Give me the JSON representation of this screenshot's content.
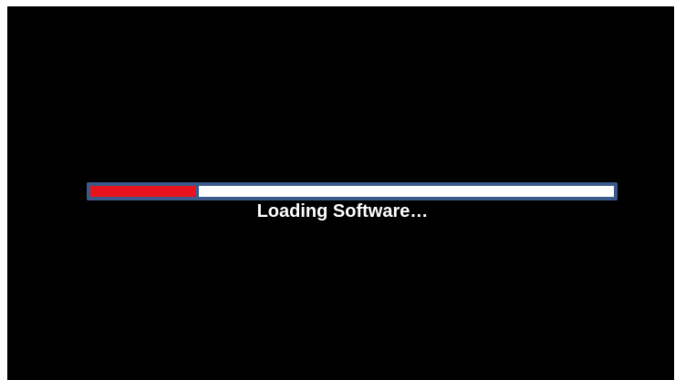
{
  "loading": {
    "message": "Loading Software…",
    "progress": 0.2
  },
  "colors": {
    "background": "#000000",
    "frame": "#3b5a8a",
    "fill": "#e8131d",
    "track": "#ffffff",
    "text": "#ffffff"
  }
}
